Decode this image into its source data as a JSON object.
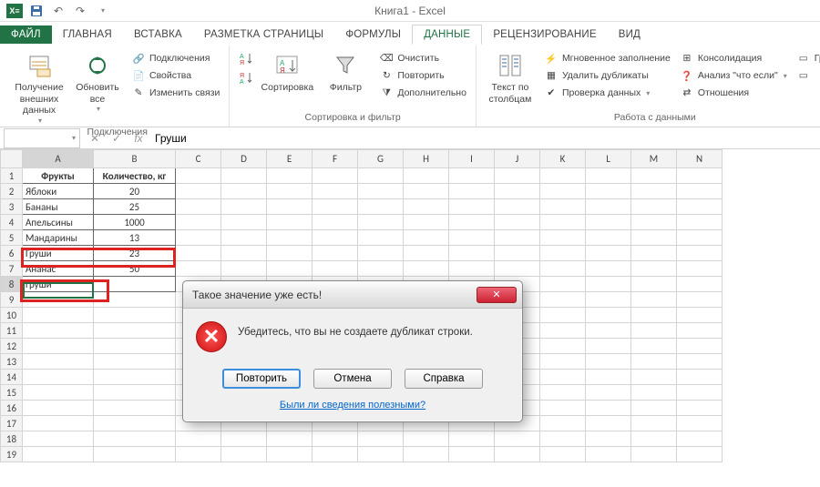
{
  "app": {
    "title": "Книга1 - Excel"
  },
  "qat": {
    "save": "💾",
    "undo": "↶",
    "redo": "↷"
  },
  "tabs": {
    "file": "ФАЙЛ",
    "home": "ГЛАВНАЯ",
    "insert": "ВСТАВКА",
    "layout": "РАЗМЕТКА СТРАНИЦЫ",
    "formulas": "ФОРМУЛЫ",
    "data": "ДАННЫЕ",
    "review": "РЕЦЕНЗИРОВАНИЕ",
    "view": "ВИД",
    "active": "data"
  },
  "ribbon": {
    "connections": {
      "getdata": "Получение\nвнешних данных",
      "refresh": "Обновить\nвсе",
      "connections": "Подключения",
      "properties": "Свойства",
      "editlinks": "Изменить связи",
      "label": "Подключения"
    },
    "sortfilter": {
      "sortA": "А↓",
      "sortZ": "А↑",
      "sort": "Сортировка",
      "filter": "Фильтр",
      "clear": "Очистить",
      "reapply": "Повторить",
      "advanced": "Дополнительно",
      "label": "Сортировка и фильтр"
    },
    "datatools": {
      "t2c": "Текст по\nстолбцам",
      "flash": "Мгновенное заполнение",
      "dup": "Удалить дубликаты",
      "valid": "Проверка данных",
      "consol": "Консолидация",
      "whatif": "Анализ \"что если\"",
      "rel": "Отношения",
      "gr": "Гр",
      "label": "Работа с данными"
    }
  },
  "formula_bar": {
    "name": "",
    "fx": "fx",
    "value": "Груши"
  },
  "columns": [
    "A",
    "B",
    "C",
    "D",
    "E",
    "F",
    "G",
    "H",
    "I",
    "J",
    "K",
    "L",
    "M",
    "N"
  ],
  "sheet": {
    "headers": {
      "a": "Фрукты",
      "b": "Количество, кг"
    },
    "rows": [
      {
        "a": "Яблоки",
        "b": "20"
      },
      {
        "a": "Бананы",
        "b": "25"
      },
      {
        "a": "Апельсины",
        "b": "1000"
      },
      {
        "a": "Мандарины",
        "b": "13"
      },
      {
        "a": "Груши",
        "b": "23"
      },
      {
        "a": "Ананас",
        "b": "50"
      },
      {
        "a": "Груши",
        "b": ""
      }
    ],
    "active_cell": "A8"
  },
  "dialog": {
    "title": "Такое значение уже есть!",
    "msg": "Убедитесь, что вы не создаете дубликат строки.",
    "retry": "Повторить",
    "cancel": "Отмена",
    "help": "Справка",
    "feedback": "Были ли сведения полезными?"
  }
}
